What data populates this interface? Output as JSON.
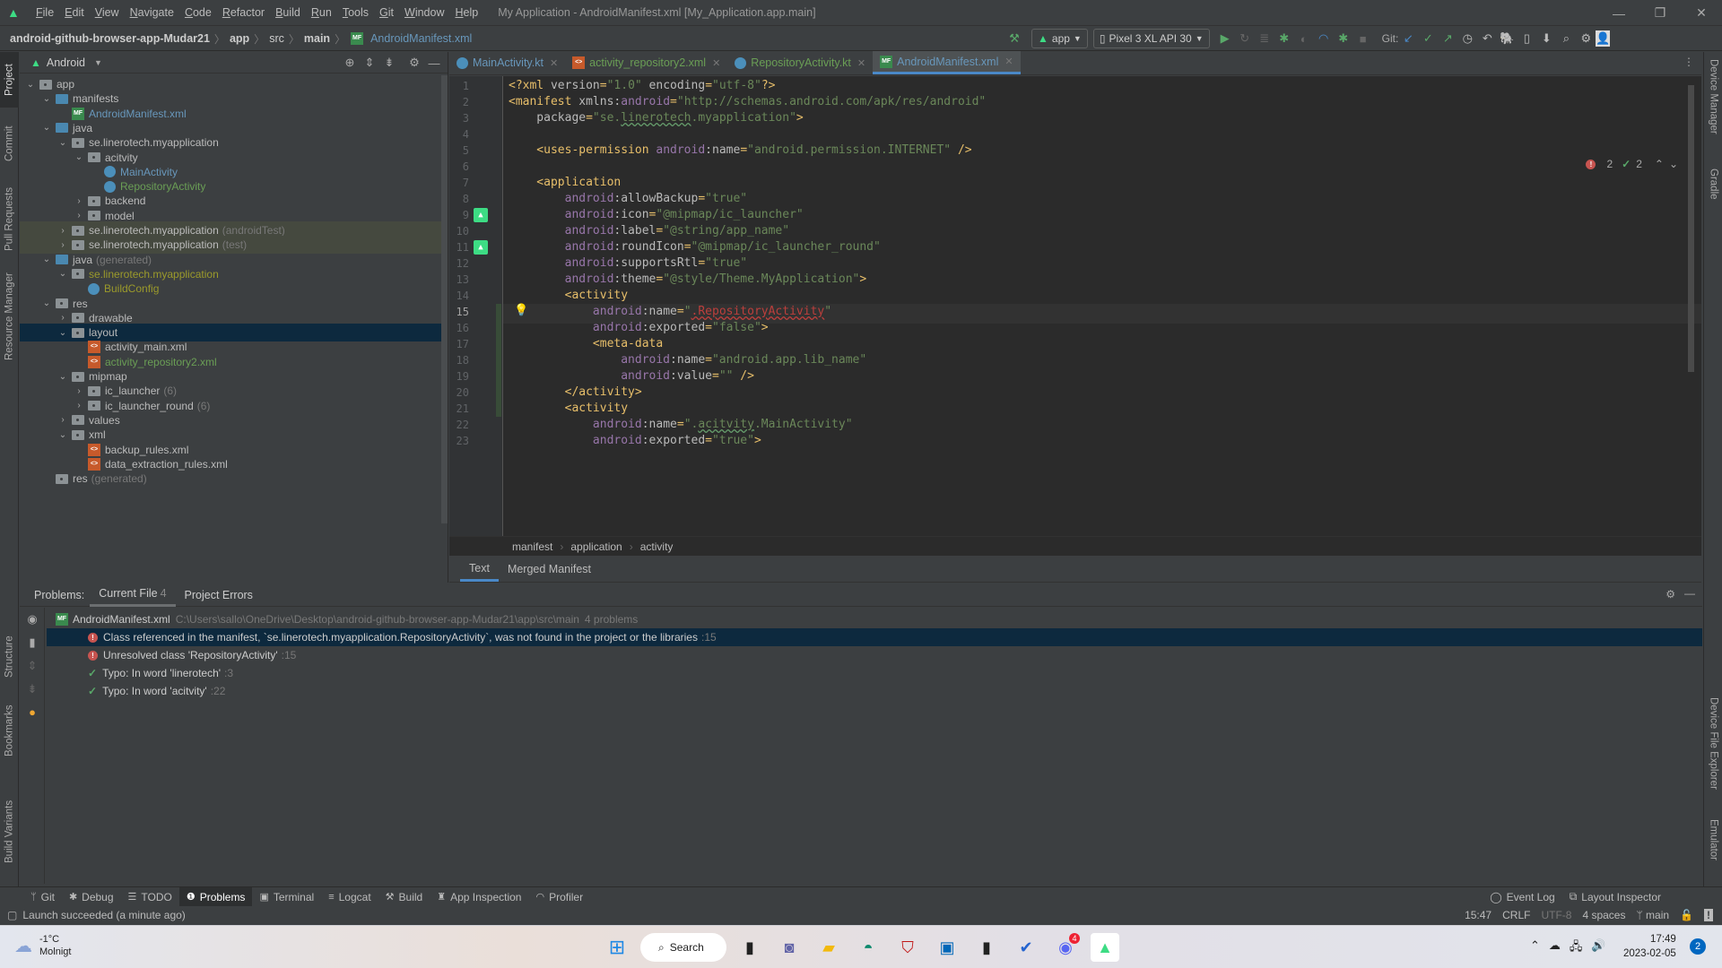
{
  "window": {
    "title": "My Application - AndroidManifest.xml [My_Application.app.main]",
    "menu": [
      {
        "label": "File",
        "u": "F",
        "rest": "ile"
      },
      {
        "label": "Edit",
        "u": "E",
        "rest": "dit"
      },
      {
        "label": "View",
        "u": "V",
        "rest": "iew"
      },
      {
        "label": "Navigate",
        "u": "N",
        "rest": "avigate"
      },
      {
        "label": "Code",
        "u": "C",
        "rest": "ode"
      },
      {
        "label": "Refactor",
        "u": "R",
        "rest": "efactor"
      },
      {
        "label": "Build",
        "u": "B",
        "rest": "uild"
      },
      {
        "label": "Run",
        "u": "R",
        "rest": "un"
      },
      {
        "label": "Tools",
        "u": "T",
        "rest": "ools"
      },
      {
        "label": "Git",
        "u": "G",
        "rest": "it"
      },
      {
        "label": "Window",
        "u": "W",
        "rest": "indow"
      },
      {
        "label": "Help",
        "u": "H",
        "rest": "elp"
      }
    ]
  },
  "breadcrumb": {
    "project": "android-github-browser-app-Mudar21",
    "module": "app",
    "src": "src",
    "main": "main",
    "file": "AndroidManifest.xml"
  },
  "toolbar": {
    "run_config": "app",
    "device": "Pixel 3 XL API 30",
    "git_label": "Git:"
  },
  "left_strip": [
    "Project",
    "Commit",
    "Pull Requests",
    "Resource Manager",
    "Structure",
    "Bookmarks",
    "Build Variants"
  ],
  "right_strip": [
    "Device Manager",
    "Gradle",
    "Device File Explorer",
    "Emulator"
  ],
  "project_panel": {
    "view": "Android",
    "tree": [
      {
        "label": "app",
        "kind": "module",
        "indent": 0,
        "open": true
      },
      {
        "label": "manifests",
        "kind": "folder-blue",
        "indent": 1,
        "open": true
      },
      {
        "label": "AndroidManifest.xml",
        "kind": "mf",
        "indent": 2,
        "color": "blue"
      },
      {
        "label": "java",
        "kind": "folder-blue",
        "indent": 1,
        "open": true
      },
      {
        "label": "se.linerotech.myapplication",
        "kind": "pkg",
        "indent": 2,
        "open": true
      },
      {
        "label": "acitvity",
        "kind": "pkg",
        "indent": 3,
        "open": true
      },
      {
        "label": "MainActivity",
        "kind": "kt",
        "indent": 4,
        "color": "blue"
      },
      {
        "label": "RepositoryActivity",
        "kind": "kt",
        "indent": 4,
        "color": "green"
      },
      {
        "label": "backend",
        "kind": "pkg",
        "indent": 3,
        "open": false
      },
      {
        "label": "model",
        "kind": "pkg",
        "indent": 3,
        "open": false
      },
      {
        "label": "se.linerotech.myapplication",
        "suffix": "(androidTest)",
        "kind": "pkg",
        "indent": 2,
        "open": false,
        "row": "green"
      },
      {
        "label": "se.linerotech.myapplication",
        "suffix": "(test)",
        "kind": "pkg",
        "indent": 2,
        "open": false,
        "row": "green"
      },
      {
        "label": "java",
        "suffix": "(generated)",
        "kind": "folder-blue",
        "indent": 1,
        "open": true
      },
      {
        "label": "se.linerotech.myapplication",
        "kind": "pkg",
        "indent": 2,
        "open": true,
        "color": "olive"
      },
      {
        "label": "BuildConfig",
        "kind": "kt",
        "indent": 3,
        "color": "olive"
      },
      {
        "label": "res",
        "kind": "folder",
        "indent": 1,
        "open": true
      },
      {
        "label": "drawable",
        "kind": "pkg",
        "indent": 2,
        "open": false
      },
      {
        "label": "layout",
        "kind": "pkg",
        "indent": 2,
        "open": true,
        "row": "sel"
      },
      {
        "label": "activity_main.xml",
        "kind": "xml",
        "indent": 3
      },
      {
        "label": "activity_repository2.xml",
        "kind": "xml",
        "indent": 3,
        "color": "green"
      },
      {
        "label": "mipmap",
        "kind": "pkg",
        "indent": 2,
        "open": true
      },
      {
        "label": "ic_launcher",
        "suffix": "(6)",
        "kind": "pkg",
        "indent": 3,
        "open": false
      },
      {
        "label": "ic_launcher_round",
        "suffix": "(6)",
        "kind": "pkg",
        "indent": 3,
        "open": false
      },
      {
        "label": "values",
        "kind": "pkg",
        "indent": 2,
        "open": false
      },
      {
        "label": "xml",
        "kind": "pkg",
        "indent": 2,
        "open": true
      },
      {
        "label": "backup_rules.xml",
        "kind": "xml",
        "indent": 3
      },
      {
        "label": "data_extraction_rules.xml",
        "kind": "xml",
        "indent": 3
      },
      {
        "label": "res",
        "suffix": "(generated)",
        "kind": "folder",
        "indent": 1
      }
    ]
  },
  "editor_tabs": [
    {
      "label": "MainActivity.kt",
      "kind": "kt",
      "color": "#6897bb",
      "active": false
    },
    {
      "label": "activity_repository2.xml",
      "kind": "xml",
      "color": "#6a9e55",
      "active": false
    },
    {
      "label": "RepositoryActivity.kt",
      "kind": "kt",
      "color": "#6a9e55",
      "active": false
    },
    {
      "label": "AndroidManifest.xml",
      "kind": "mf",
      "color": "#6897bb",
      "active": true
    }
  ],
  "editor": {
    "current_line": 15,
    "error_count": "2",
    "typo_count": "2",
    "lines": [
      [
        [
          "tag",
          "<?xml "
        ],
        [
          "attr",
          "version"
        ],
        [
          "tag",
          "="
        ],
        [
          "str",
          "\"1.0\""
        ],
        [
          "attr",
          " encoding"
        ],
        [
          "tag",
          "="
        ],
        [
          "str",
          "\"utf-8\""
        ],
        [
          "tag",
          "?>"
        ]
      ],
      [
        [
          "tag",
          "<manifest "
        ],
        [
          "attr",
          "xmlns:"
        ],
        [
          "ns",
          "android"
        ],
        [
          "tag",
          "="
        ],
        [
          "str",
          "\"http://schemas.android.com/apk/res/android\""
        ]
      ],
      [
        [
          "attr",
          "    package"
        ],
        [
          "tag",
          "="
        ],
        [
          "str",
          "\"se."
        ],
        [
          "str typo",
          "linerotech"
        ],
        [
          "str",
          ".myapplication\""
        ],
        [
          "tag",
          ">"
        ]
      ],
      [],
      [
        [
          "tag",
          "    <uses-permission "
        ],
        [
          "ns",
          "android"
        ],
        [
          "attr",
          ":name"
        ],
        [
          "tag",
          "="
        ],
        [
          "str",
          "\"android.permission.INTERNET\""
        ],
        [
          "tag",
          " />"
        ]
      ],
      [],
      [
        [
          "tag",
          "    <application"
        ]
      ],
      [
        [
          "ns",
          "        android"
        ],
        [
          "attr",
          ":allowBackup"
        ],
        [
          "tag",
          "="
        ],
        [
          "str",
          "\"true\""
        ]
      ],
      [
        [
          "ns",
          "        android"
        ],
        [
          "attr",
          ":icon"
        ],
        [
          "tag",
          "="
        ],
        [
          "str",
          "\"@mipmap/ic_launcher\""
        ]
      ],
      [
        [
          "ns",
          "        android"
        ],
        [
          "attr",
          ":label"
        ],
        [
          "tag",
          "="
        ],
        [
          "str",
          "\"@string/app_name\""
        ]
      ],
      [
        [
          "ns",
          "        android"
        ],
        [
          "attr",
          ":roundIcon"
        ],
        [
          "tag",
          "="
        ],
        [
          "str",
          "\"@mipmap/ic_launcher_round\""
        ]
      ],
      [
        [
          "ns",
          "        android"
        ],
        [
          "attr",
          ":supportsRtl"
        ],
        [
          "tag",
          "="
        ],
        [
          "str",
          "\"true\""
        ]
      ],
      [
        [
          "ns",
          "        android"
        ],
        [
          "attr",
          ":theme"
        ],
        [
          "tag",
          "="
        ],
        [
          "str",
          "\"@style/Theme.MyApplication\""
        ],
        [
          "tag",
          ">"
        ]
      ],
      [
        [
          "tag",
          "        <activity"
        ]
      ],
      [
        [
          "ns",
          "            android"
        ],
        [
          "attr",
          ":name"
        ],
        [
          "tag",
          "="
        ],
        [
          "str",
          "\""
        ],
        [
          "err",
          ".RepositoryActivity"
        ],
        [
          "str",
          "\""
        ]
      ],
      [
        [
          "ns",
          "            android"
        ],
        [
          "attr",
          ":exported"
        ],
        [
          "tag",
          "="
        ],
        [
          "str",
          "\"false\""
        ],
        [
          "tag",
          ">"
        ]
      ],
      [
        [
          "tag",
          "            <meta-data"
        ]
      ],
      [
        [
          "ns",
          "                android"
        ],
        [
          "attr",
          ":name"
        ],
        [
          "tag",
          "="
        ],
        [
          "str",
          "\"android.app.lib_name\""
        ]
      ],
      [
        [
          "ns",
          "                android"
        ],
        [
          "attr",
          ":value"
        ],
        [
          "tag",
          "="
        ],
        [
          "str",
          "\"\""
        ],
        [
          "tag",
          " />"
        ]
      ],
      [
        [
          "tag",
          "        </activity>"
        ]
      ],
      [
        [
          "tag",
          "        <activity"
        ]
      ],
      [
        [
          "ns",
          "            android"
        ],
        [
          "attr",
          ":name"
        ],
        [
          "tag",
          "="
        ],
        [
          "str",
          "\"."
        ],
        [
          "str typo",
          "acitvity"
        ],
        [
          "str",
          ".MainActivity\""
        ]
      ],
      [
        [
          "ns",
          "            android"
        ],
        [
          "attr",
          ":exported"
        ],
        [
          "tag",
          "="
        ],
        [
          "str",
          "\"true\""
        ],
        [
          "tag",
          ">"
        ]
      ]
    ],
    "structure_crumbs": [
      "manifest",
      "application",
      "activity"
    ],
    "bottom_tabs": [
      {
        "label": "Text",
        "active": true
      },
      {
        "label": "Merged Manifest",
        "active": false
      }
    ]
  },
  "problems": {
    "label": "Problems:",
    "tabs": [
      {
        "label": "Current File",
        "count": "4",
        "active": true
      },
      {
        "label": "Project Errors",
        "count": "",
        "active": false
      }
    ],
    "file": "AndroidManifest.xml",
    "path": "C:\\Users\\sallo\\OneDrive\\Desktop\\android-github-browser-app-Mudar21\\app\\src\\main",
    "summary": "4 problems",
    "items": [
      {
        "severity": "error",
        "text": "Class referenced in the manifest, `se.linerotech.myapplication.RepositoryActivity`, was not found in the project or the libraries",
        "line": ":15",
        "selected": true
      },
      {
        "severity": "error",
        "text": "Unresolved class 'RepositoryActivity'",
        "line": ":15",
        "selected": false
      },
      {
        "severity": "typo",
        "text": "Typo: In word 'linerotech'",
        "line": ":3",
        "selected": false
      },
      {
        "severity": "typo",
        "text": "Typo: In word 'acitvity'",
        "line": ":22",
        "selected": false
      }
    ]
  },
  "tool_windows": [
    {
      "label": "Git",
      "icon": "git-icon",
      "glyph": "ᛘ",
      "active": false
    },
    {
      "label": "Debug",
      "icon": "bug-icon",
      "glyph": "✱",
      "active": false
    },
    {
      "label": "TODO",
      "icon": "list-icon",
      "glyph": "☰",
      "active": false
    },
    {
      "label": "Problems",
      "icon": "problems-icon",
      "glyph": "❶",
      "active": true
    },
    {
      "label": "Terminal",
      "icon": "terminal-icon",
      "glyph": "▣",
      "active": false
    },
    {
      "label": "Logcat",
      "icon": "logcat-icon",
      "glyph": "≡",
      "active": false
    },
    {
      "label": "Build",
      "icon": "hammer-icon",
      "glyph": "⚒",
      "active": false
    },
    {
      "label": "App Inspection",
      "icon": "inspection-icon",
      "glyph": "♜",
      "active": false
    },
    {
      "label": "Profiler",
      "icon": "gauge-icon",
      "glyph": "◠",
      "active": false
    }
  ],
  "tool_windows_right": [
    {
      "label": "Event Log",
      "icon": "event-log-icon",
      "glyph": "◯"
    },
    {
      "label": "Layout Inspector",
      "icon": "layout-inspector-icon",
      "glyph": "⧉"
    }
  ],
  "status": {
    "message": "Launch succeeded (a minute ago)",
    "position": "15:47",
    "line_sep": "CRLF",
    "encoding": "UTF-8",
    "indent": "4 spaces",
    "branch": "main"
  },
  "taskbar": {
    "weather_temp": "-1°C",
    "weather_desc": "Molnigt",
    "search_label": "Search",
    "time": "17:49",
    "date": "2023-02-05",
    "notification_count": "2",
    "discord_badge": "4"
  }
}
